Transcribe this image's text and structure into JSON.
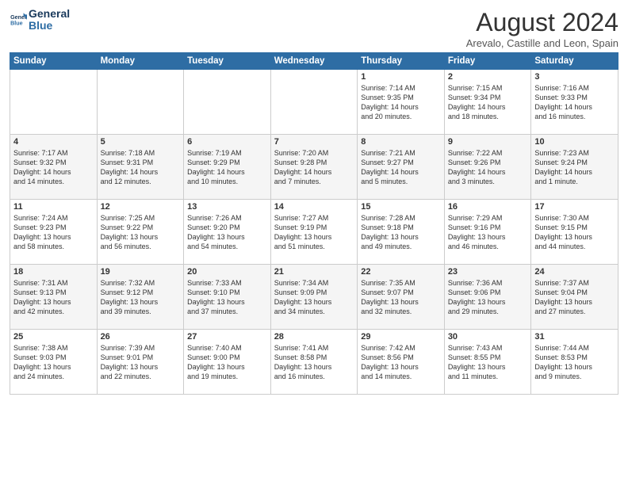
{
  "header": {
    "logo_line1": "General",
    "logo_line2": "Blue",
    "month_title": "August 2024",
    "subtitle": "Arevalo, Castille and Leon, Spain"
  },
  "weekdays": [
    "Sunday",
    "Monday",
    "Tuesday",
    "Wednesday",
    "Thursday",
    "Friday",
    "Saturday"
  ],
  "weeks": [
    [
      {
        "day": "",
        "info": ""
      },
      {
        "day": "",
        "info": ""
      },
      {
        "day": "",
        "info": ""
      },
      {
        "day": "",
        "info": ""
      },
      {
        "day": "1",
        "info": "Sunrise: 7:14 AM\nSunset: 9:35 PM\nDaylight: 14 hours\nand 20 minutes."
      },
      {
        "day": "2",
        "info": "Sunrise: 7:15 AM\nSunset: 9:34 PM\nDaylight: 14 hours\nand 18 minutes."
      },
      {
        "day": "3",
        "info": "Sunrise: 7:16 AM\nSunset: 9:33 PM\nDaylight: 14 hours\nand 16 minutes."
      }
    ],
    [
      {
        "day": "4",
        "info": "Sunrise: 7:17 AM\nSunset: 9:32 PM\nDaylight: 14 hours\nand 14 minutes."
      },
      {
        "day": "5",
        "info": "Sunrise: 7:18 AM\nSunset: 9:31 PM\nDaylight: 14 hours\nand 12 minutes."
      },
      {
        "day": "6",
        "info": "Sunrise: 7:19 AM\nSunset: 9:29 PM\nDaylight: 14 hours\nand 10 minutes."
      },
      {
        "day": "7",
        "info": "Sunrise: 7:20 AM\nSunset: 9:28 PM\nDaylight: 14 hours\nand 7 minutes."
      },
      {
        "day": "8",
        "info": "Sunrise: 7:21 AM\nSunset: 9:27 PM\nDaylight: 14 hours\nand 5 minutes."
      },
      {
        "day": "9",
        "info": "Sunrise: 7:22 AM\nSunset: 9:26 PM\nDaylight: 14 hours\nand 3 minutes."
      },
      {
        "day": "10",
        "info": "Sunrise: 7:23 AM\nSunset: 9:24 PM\nDaylight: 14 hours\nand 1 minute."
      }
    ],
    [
      {
        "day": "11",
        "info": "Sunrise: 7:24 AM\nSunset: 9:23 PM\nDaylight: 13 hours\nand 58 minutes."
      },
      {
        "day": "12",
        "info": "Sunrise: 7:25 AM\nSunset: 9:22 PM\nDaylight: 13 hours\nand 56 minutes."
      },
      {
        "day": "13",
        "info": "Sunrise: 7:26 AM\nSunset: 9:20 PM\nDaylight: 13 hours\nand 54 minutes."
      },
      {
        "day": "14",
        "info": "Sunrise: 7:27 AM\nSunset: 9:19 PM\nDaylight: 13 hours\nand 51 minutes."
      },
      {
        "day": "15",
        "info": "Sunrise: 7:28 AM\nSunset: 9:18 PM\nDaylight: 13 hours\nand 49 minutes."
      },
      {
        "day": "16",
        "info": "Sunrise: 7:29 AM\nSunset: 9:16 PM\nDaylight: 13 hours\nand 46 minutes."
      },
      {
        "day": "17",
        "info": "Sunrise: 7:30 AM\nSunset: 9:15 PM\nDaylight: 13 hours\nand 44 minutes."
      }
    ],
    [
      {
        "day": "18",
        "info": "Sunrise: 7:31 AM\nSunset: 9:13 PM\nDaylight: 13 hours\nand 42 minutes."
      },
      {
        "day": "19",
        "info": "Sunrise: 7:32 AM\nSunset: 9:12 PM\nDaylight: 13 hours\nand 39 minutes."
      },
      {
        "day": "20",
        "info": "Sunrise: 7:33 AM\nSunset: 9:10 PM\nDaylight: 13 hours\nand 37 minutes."
      },
      {
        "day": "21",
        "info": "Sunrise: 7:34 AM\nSunset: 9:09 PM\nDaylight: 13 hours\nand 34 minutes."
      },
      {
        "day": "22",
        "info": "Sunrise: 7:35 AM\nSunset: 9:07 PM\nDaylight: 13 hours\nand 32 minutes."
      },
      {
        "day": "23",
        "info": "Sunrise: 7:36 AM\nSunset: 9:06 PM\nDaylight: 13 hours\nand 29 minutes."
      },
      {
        "day": "24",
        "info": "Sunrise: 7:37 AM\nSunset: 9:04 PM\nDaylight: 13 hours\nand 27 minutes."
      }
    ],
    [
      {
        "day": "25",
        "info": "Sunrise: 7:38 AM\nSunset: 9:03 PM\nDaylight: 13 hours\nand 24 minutes."
      },
      {
        "day": "26",
        "info": "Sunrise: 7:39 AM\nSunset: 9:01 PM\nDaylight: 13 hours\nand 22 minutes."
      },
      {
        "day": "27",
        "info": "Sunrise: 7:40 AM\nSunset: 9:00 PM\nDaylight: 13 hours\nand 19 minutes."
      },
      {
        "day": "28",
        "info": "Sunrise: 7:41 AM\nSunset: 8:58 PM\nDaylight: 13 hours\nand 16 minutes."
      },
      {
        "day": "29",
        "info": "Sunrise: 7:42 AM\nSunset: 8:56 PM\nDaylight: 13 hours\nand 14 minutes."
      },
      {
        "day": "30",
        "info": "Sunrise: 7:43 AM\nSunset: 8:55 PM\nDaylight: 13 hours\nand 11 minutes."
      },
      {
        "day": "31",
        "info": "Sunrise: 7:44 AM\nSunset: 8:53 PM\nDaylight: 13 hours\nand 9 minutes."
      }
    ]
  ]
}
